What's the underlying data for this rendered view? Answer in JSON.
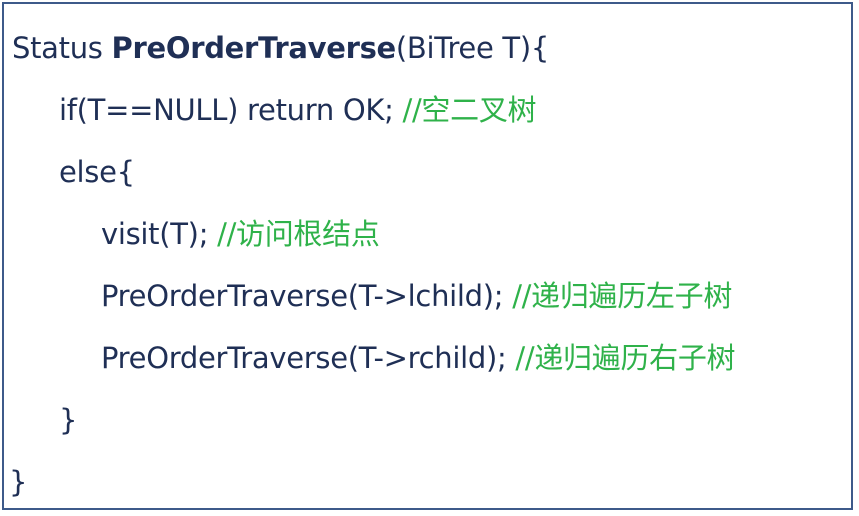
{
  "code": {
    "line1": {
      "prefix": "Status ",
      "func": "PreOrderTraverse",
      "suffix": "(BiTree T){"
    },
    "line2": {
      "code": "if(T==NULL) return OK; ",
      "comment": "//空二叉树"
    },
    "line3": {
      "code": "else{"
    },
    "line4": {
      "code": "visit(T); ",
      "comment": "//访问根结点"
    },
    "line5": {
      "code": "PreOrderTraverse(T->lchild); ",
      "comment": "//递归遍历左子树"
    },
    "line6": {
      "code": "PreOrderTraverse(T->rchild); ",
      "comment": "//递归遍历右子树"
    },
    "line7": {
      "code": "}"
    },
    "line8": {
      "code": "}"
    }
  },
  "colors": {
    "code_text": "#1f2f55",
    "comment": "#2fb24a",
    "border": "#3d5a8a"
  }
}
